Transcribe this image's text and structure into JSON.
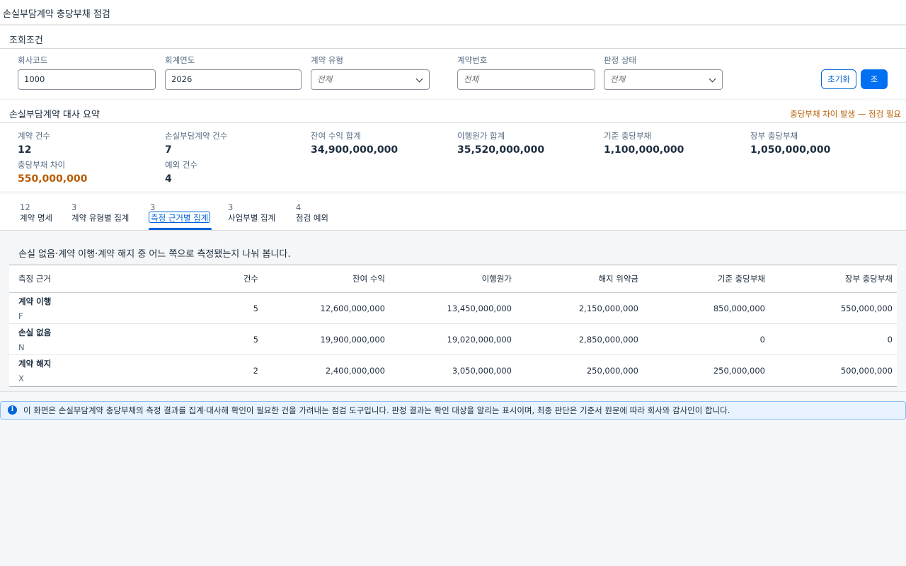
{
  "page": {
    "title": "손실부담계약 충당부채 점검"
  },
  "filters": {
    "section_title": "조회조건",
    "company_code": {
      "label": "회사코드",
      "value": "1000"
    },
    "fiscal_year": {
      "label": "회계연도",
      "value": "2026"
    },
    "contract_type": {
      "label": "계약 유형",
      "placeholder": "전체"
    },
    "contract_no": {
      "label": "계약번호",
      "placeholder": "전체"
    },
    "judgment_status": {
      "label": "판정 상태",
      "placeholder": "전체"
    },
    "reset_label": "초기화",
    "search_label": "조회"
  },
  "summary": {
    "section_title": "손실부담계약 대사 요약",
    "warning": "충당부채 차이 발생 — 점검 필요",
    "kpis": [
      {
        "label": "계약 건수",
        "value": "12"
      },
      {
        "label": "손실부담계약 건수",
        "value": "7"
      },
      {
        "label": "잔여 수익 합계",
        "value": "34,900,000,000"
      },
      {
        "label": "이행원가 합계",
        "value": "35,520,000,000"
      },
      {
        "label": "기준 충당부채",
        "value": "1,100,000,000"
      },
      {
        "label": "장부 충당부채",
        "value": "1,050,000,000"
      },
      {
        "label": "충당부채 차이",
        "value": "550,000,000"
      },
      {
        "label": "예외 건수",
        "value": "4"
      }
    ]
  },
  "tabs": [
    {
      "count": "12",
      "label": "계약 명세"
    },
    {
      "count": "3",
      "label": "계약 유형별 집계"
    },
    {
      "count": "3",
      "label": "측정 근거별 집계"
    },
    {
      "count": "3",
      "label": "사업부별 집계"
    },
    {
      "count": "4",
      "label": "점검 예외"
    }
  ],
  "table": {
    "description": "손실 없음·계약 이행·계약 해지 중 어느 쪽으로 측정됐는지 나눠 봅니다.",
    "columns": [
      "측정 근거",
      "건수",
      "잔여 수익",
      "이행원가",
      "해지 위약금",
      "기준 충당부채",
      "장부 충당부채"
    ],
    "rows": [
      {
        "basis": "계약 이행",
        "code": "F",
        "count": "5",
        "revenue": "12,600,000,000",
        "cost": "13,450,000,000",
        "penalty": "2,150,000,000",
        "std_provision": "850,000,000",
        "book_provision": "550,000,000"
      },
      {
        "basis": "손실 없음",
        "code": "N",
        "count": "5",
        "revenue": "19,900,000,000",
        "cost": "19,020,000,000",
        "penalty": "2,850,000,000",
        "std_provision": "0",
        "book_provision": "0"
      },
      {
        "basis": "계약 해지",
        "code": "X",
        "count": "2",
        "revenue": "2,400,000,000",
        "cost": "3,050,000,000",
        "penalty": "250,000,000",
        "std_provision": "250,000,000",
        "book_provision": "500,000,000"
      }
    ]
  },
  "info": {
    "icon": "info-icon",
    "text": "이 화면은 손실부담계약 충당부채의 측정 결과를 집계·대사해 확인이 필요한 건을 가려내는 점검 도구입니다. 판정 결과는 확인 대상을 알리는 표시이며, 최종 판단은 기준서 원문에 따라 회사와 감사인이 합니다."
  },
  "colors": {
    "accent": "#0070f2",
    "warning": "#b85c00",
    "info_bg": "#e8f3ff"
  }
}
